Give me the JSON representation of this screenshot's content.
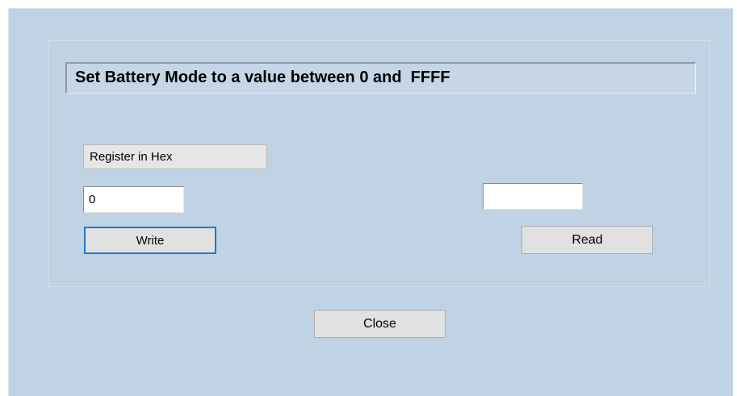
{
  "dialog": {
    "title_text": "Set Battery Mode to a value between 0 and  FFFF",
    "register_label": "Register in Hex",
    "register_value": "0",
    "read_value": "",
    "write_label": "Write",
    "read_label": "Read",
    "close_label": "Close"
  },
  "colors": {
    "dialog_background": "#c0d3e5",
    "button_face": "#e1e1e1",
    "focus_border": "#1c79d4"
  }
}
